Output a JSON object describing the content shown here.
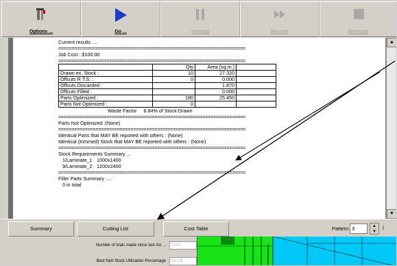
{
  "toolbar": {
    "buttons": [
      {
        "label": "Options ...",
        "icon": "tools-icon",
        "enabled": true
      },
      {
        "label": "Go ...",
        "icon": "play-icon",
        "enabled": true
      },
      {
        "label": "Interrupt",
        "icon": "pause-icon",
        "enabled": false
      },
      {
        "label": "Resume",
        "icon": "fast-forward-icon",
        "enabled": false
      },
      {
        "label": "Terminate",
        "icon": "stop-icon",
        "enabled": false
      }
    ]
  },
  "report": {
    "separator": "======================================================================",
    "current_results": "Current results ....",
    "job_cost": "Job Cost : $100.00",
    "table": {
      "headers": [
        "",
        "Qty",
        "Area (sq.m.)"
      ],
      "rows": [
        [
          "Drawn ex. Stock  :",
          "10",
          "27.320"
        ],
        [
          "Offcuts R.T.S.   :",
          "0",
          "0.000"
        ],
        [
          "Offcuts Discarded :",
          "",
          "1.870"
        ],
        [
          "Offcuts Filled   :",
          "",
          "0.000"
        ],
        [
          "Parts Optimized   :",
          "180",
          "25.450"
        ],
        [
          "Parts Not Optimized :",
          "0",
          ""
        ]
      ],
      "waste_factor": "Waste Factor     6.84% of Stock Drawn"
    },
    "parts_not_optimized": "Parts Not Optimized :(None)",
    "identical_parts": "Identical Parts that MAY BE reported with others : (None)",
    "identical_stock": "Identical (trimmed) Stock that MAY BE reported with others : (None)",
    "stock_summary_title": "Stock Requirements Summary ...",
    "stock_items": [
      {
        "name": "1/Laminate_1",
        "size": "1000x1400"
      },
      {
        "name": "9/Laminate_2",
        "size": "1200x2400"
      }
    ],
    "filler_title": "Filler Parts Summary ....",
    "filler_total": "0 in total"
  },
  "tabs": {
    "summary": "Summary",
    "cutting_list": "Cutting List",
    "cost_table": "Cost Table"
  },
  "pattern": {
    "label": "Pattern",
    "value": "3",
    "slash": "/"
  },
  "stats": {
    "trials_label": "Number of trials made since last Go ...",
    "trials_value": "1147",
    "utilization_label": "Best Nett Stock Utilization Percentage",
    "utilization_value": "93.16"
  },
  "colors": {
    "preview_bg": "#00c8f8",
    "part_green": "#17e317",
    "dark_green": "#0a8a0a",
    "toolbar_bg": "#d4d0c8",
    "play_blue": "#1c3cc8"
  }
}
